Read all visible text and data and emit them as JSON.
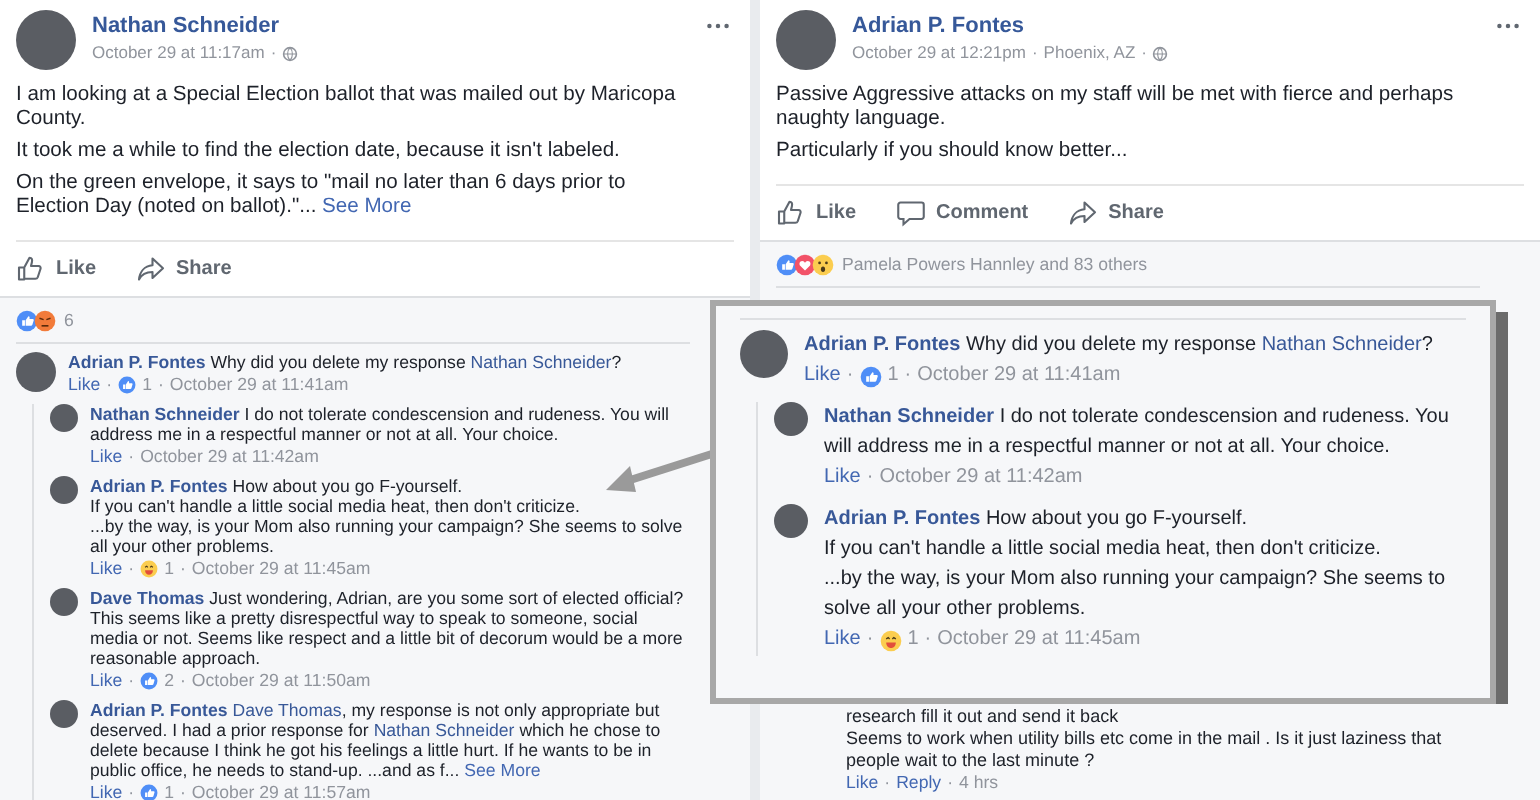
{
  "meta_separator": "·",
  "posts": [
    {
      "author": "Nathan Schneider",
      "time": "October 29 at 11:17am",
      "body": [
        "I am looking at a Special Election ballot that was mailed out by Maricopa County.",
        "It took me a while to find the election date, because it isn't labeled.",
        "On the green envelope, it says to \"mail no later than 6 days prior to Election Day (noted on ballot).\"..."
      ],
      "see_more": "See More",
      "actions": [
        {
          "kind": "like",
          "label": "Like"
        },
        {
          "kind": "share",
          "label": "Share"
        }
      ],
      "reactions": {
        "icons": [
          {
            "kind": "like"
          },
          {
            "kind": "angry"
          }
        ],
        "text": "6"
      },
      "comments": [
        {
          "author": "Adrian P. Fontes",
          "segments": [
            {
              "kind": "text",
              "text": "Why did you delete my response "
            },
            {
              "kind": "mention",
              "text": "Nathan Schneider"
            },
            {
              "kind": "text",
              "text": "?"
            }
          ],
          "meta": [
            {
              "kind": "action",
              "text": "Like"
            },
            {
              "kind": "like_reaction",
              "count": "1"
            },
            {
              "kind": "time",
              "text": "October 29 at 11:41am"
            }
          ],
          "children": [
            {
              "author": "Nathan Schneider",
              "segments": [
                {
                  "kind": "text",
                  "text": "I do not tolerate condescension and rudeness. You will address me in a respectful manner or not at all. Your choice."
                }
              ],
              "meta": [
                {
                  "kind": "action",
                  "text": "Like"
                },
                {
                  "kind": "time",
                  "text": "October 29 at 11:42am"
                }
              ]
            },
            {
              "author": "Adrian P. Fontes",
              "segments": [
                {
                  "kind": "text",
                  "text": "How about you go F-yourself.\nIf you can't handle a little social media heat, then don't criticize.\n...by the way, is your Mom also running your campaign? She seems to solve all your other problems."
                }
              ],
              "meta": [
                {
                  "kind": "action",
                  "text": "Like"
                },
                {
                  "kind": "haha_reaction",
                  "count": "1"
                },
                {
                  "kind": "time",
                  "text": "October 29 at 11:45am"
                }
              ]
            },
            {
              "author": "Dave Thomas",
              "segments": [
                {
                  "kind": "text",
                  "text": "Just wondering, Adrian, are you some sort of elected official? This seems like a pretty disrespectful way to speak to someone, social media or not. Seems like respect and a little bit of decorum would be a more reasonable approach."
                }
              ],
              "meta": [
                {
                  "kind": "action",
                  "text": "Like"
                },
                {
                  "kind": "like_reaction",
                  "count": "2"
                },
                {
                  "kind": "time",
                  "text": "October 29 at 11:50am"
                }
              ]
            },
            {
              "author": "Adrian P. Fontes",
              "segments": [
                {
                  "kind": "mention",
                  "text": "Dave Thomas"
                },
                {
                  "kind": "text",
                  "text": ", my response is not only appropriate but deserved. I had a prior response for "
                },
                {
                  "kind": "mention",
                  "text": "Nathan Schneider"
                },
                {
                  "kind": "text",
                  "text": " which he chose to delete because I think he got his feelings a little hurt. If he wants to be in public office, he needs to stand-up. ...and as f... "
                },
                {
                  "kind": "link",
                  "text": "See More"
                }
              ],
              "meta": [
                {
                  "kind": "action",
                  "text": "Like"
                },
                {
                  "kind": "like_reaction",
                  "count": "1"
                },
                {
                  "kind": "time",
                  "text": "October 29 at 11:57am"
                }
              ]
            }
          ]
        }
      ]
    },
    {
      "author": "Adrian P. Fontes",
      "time": "October 29 at 12:21pm",
      "location": "Phoenix, AZ",
      "body": [
        "Passive Aggressive attacks on my staff will be met with fierce and perhaps naughty language.",
        "Particularly if you should know better..."
      ],
      "actions": [
        {
          "kind": "like",
          "label": "Like"
        },
        {
          "kind": "comment",
          "label": "Comment"
        },
        {
          "kind": "share",
          "label": "Share"
        }
      ],
      "reactions": {
        "icons": [
          {
            "kind": "like"
          },
          {
            "kind": "love"
          },
          {
            "kind": "wow"
          }
        ],
        "text": "Pamela Powers Hannley and 83 others"
      },
      "partial_comment": {
        "lines": [
          "research fill it out and send it back",
          "Seems to work when utility bills etc come in the mail . Is it just laziness that people wait to the last minute ?"
        ],
        "meta": [
          {
            "kind": "action",
            "text": "Like"
          },
          {
            "kind": "action",
            "text": "Reply"
          },
          {
            "kind": "time",
            "text": "4 hrs"
          }
        ]
      }
    }
  ],
  "callout": {
    "comments": [
      {
        "author": "Adrian P. Fontes",
        "segments": [
          {
            "kind": "text",
            "text": "Why did you delete my response "
          },
          {
            "kind": "mention",
            "text": "Nathan Schneider"
          },
          {
            "kind": "text",
            "text": "?"
          }
        ],
        "meta": [
          {
            "kind": "action",
            "text": "Like"
          },
          {
            "kind": "like_reaction",
            "count": "1"
          },
          {
            "kind": "time",
            "text": "October 29 at 11:41am"
          }
        ],
        "children": [
          {
            "author": "Nathan Schneider",
            "segments": [
              {
                "kind": "text",
                "text": "I do not tolerate condescension and rudeness. You will address me in a respectful manner or not at all. Your choice."
              }
            ],
            "meta": [
              {
                "kind": "action",
                "text": "Like"
              },
              {
                "kind": "time",
                "text": "October 29 at 11:42am"
              }
            ]
          },
          {
            "author": "Adrian P. Fontes",
            "segments": [
              {
                "kind": "text",
                "text": "How about you go F-yourself.\nIf you can't handle a little social media heat, then don't criticize.\n...by the way, is your Mom also running your campaign? She seems to solve all your other problems."
              }
            ],
            "meta": [
              {
                "kind": "action",
                "text": "Like"
              },
              {
                "kind": "haha_reaction",
                "count": "1"
              },
              {
                "kind": "time",
                "text": "October 29 at 11:45am"
              }
            ]
          }
        ]
      }
    ]
  }
}
